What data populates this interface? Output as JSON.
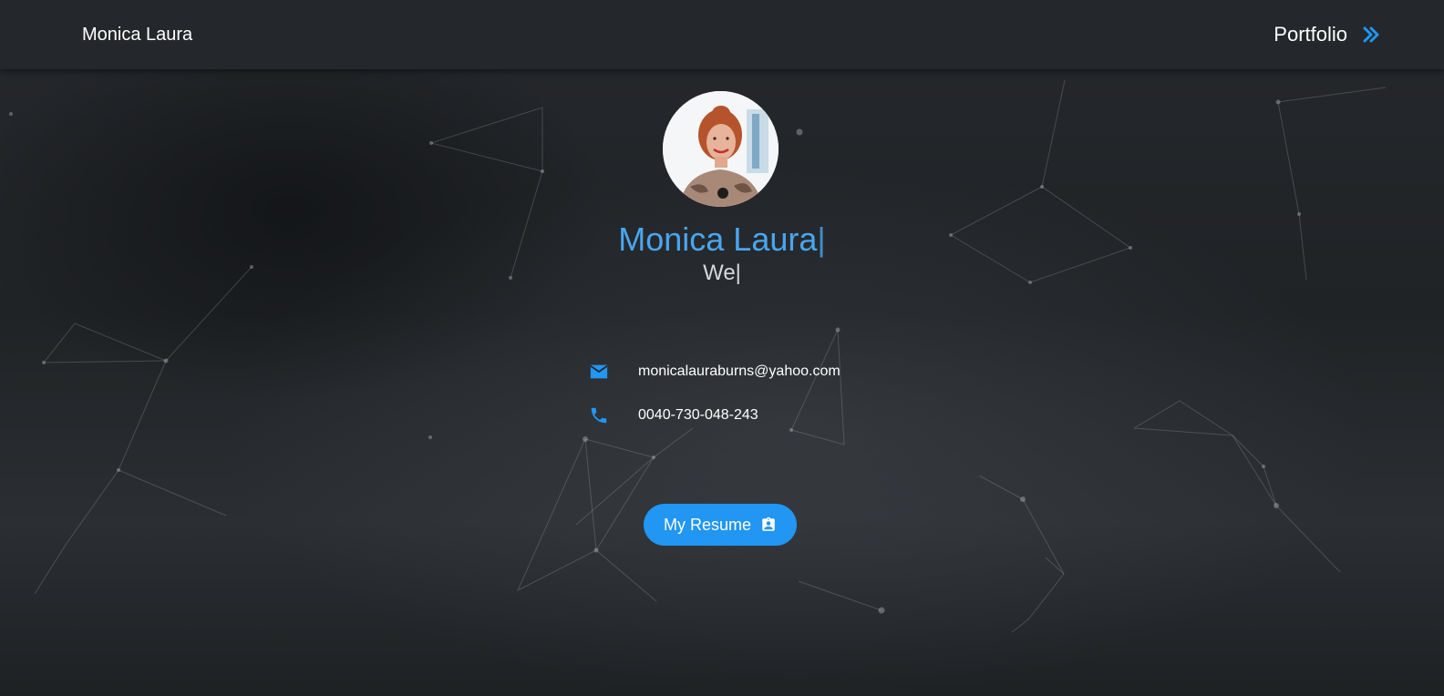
{
  "navbar": {
    "brand": "Monica Laura",
    "portfolio_label": "Portfolio"
  },
  "hero": {
    "name": "Monica Laura",
    "name_cursor": "|",
    "typed_text": "We",
    "typed_cursor": "|",
    "email": "monicalauraburns@yahoo.com",
    "phone": "0040-730-048-243",
    "resume_label": "My Resume"
  },
  "icons": {
    "email": "email-icon",
    "phone": "phone-icon",
    "resume": "contact-badge-icon",
    "portfolio": "double-chevron-right-icon"
  },
  "colors": {
    "accent": "#2196f3",
    "name": "#4aa6ef",
    "navbar": "#24282c"
  }
}
